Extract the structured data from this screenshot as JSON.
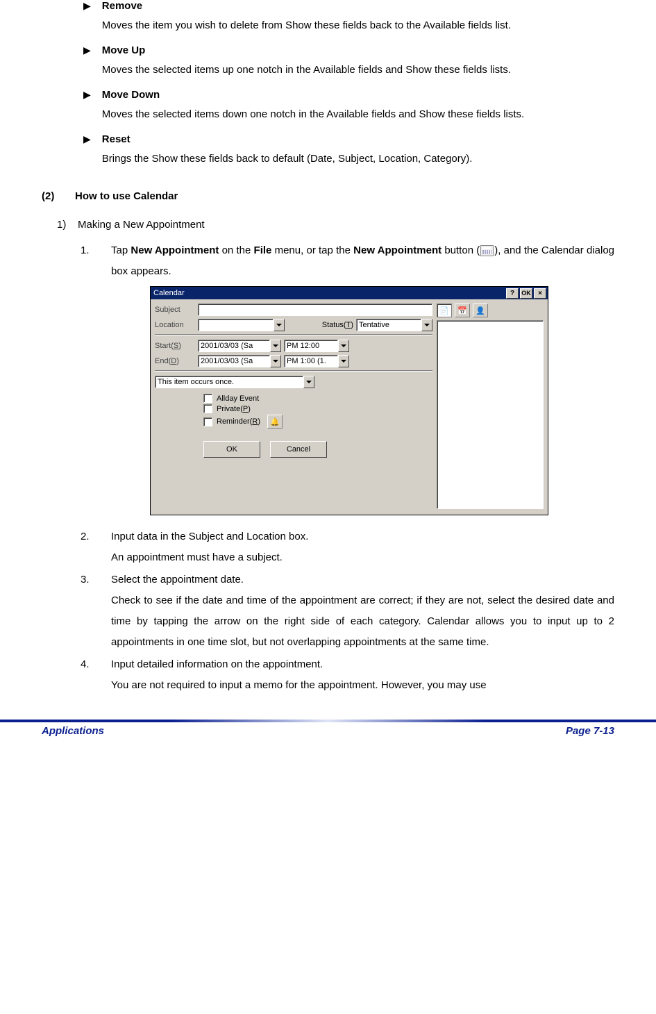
{
  "bullets": [
    {
      "title": "Remove",
      "desc": "Moves the item you wish to delete from Show these fields back to the Available fields list."
    },
    {
      "title": "Move Up",
      "desc": "Moves the selected items up one notch in the Available fields and Show these fields lists."
    },
    {
      "title": "Move Down",
      "desc": "Moves the selected items down one notch in the Available fields and Show these fields lists."
    },
    {
      "title": "Reset",
      "desc": "Brings the Show these fields back to default (Date, Subject, Location, Category)."
    }
  ],
  "section": {
    "num": "(2)",
    "title": "How to use Calendar"
  },
  "sub": {
    "num": "1)",
    "title": "Making a New Appointment"
  },
  "steps": {
    "s1": {
      "num": "1.",
      "lead_a": "Tap ",
      "b1": "New Appointment",
      "mid1": " on the ",
      "b2": "File",
      "mid2": " menu, or tap the ",
      "b3": "New Appointment",
      "tail": " button (",
      "tail2": "), and the Calendar dialog box appears."
    },
    "s2": {
      "num": "2.",
      "text": "Input data in the Subject and Location box.",
      "sub": "An appointment must have a subject."
    },
    "s3": {
      "num": "3.",
      "text": "Select the appointment date.",
      "sub": "Check to see if the date and time of the appointment are correct; if they are not, select the desired date and time by tapping the arrow on the right side of each category. Calendar allows you to input up to 2 appointments in one time slot, but not overlapping appointments at the same time."
    },
    "s4": {
      "num": "4.",
      "text": "Input detailed information on the appointment.",
      "sub": "You are not required to input a memo for the appointment. However, you may use"
    }
  },
  "dialog": {
    "title": "Calendar",
    "help": "?",
    "ok_cap": "OK",
    "close": "×",
    "subject_lbl": "Subject",
    "location_lbl": "Location",
    "status_lbl": "Status(",
    "status_key": "T",
    "status_lbl2": ")",
    "status_val": "Tentative",
    "start_lbl": "Start(",
    "start_key": "S",
    "start_lbl2": ")",
    "end_lbl": "End(",
    "end_key": "D",
    "end_lbl2": ")",
    "start_date": "2001/03/03 (Sa",
    "end_date": "2001/03/03 (Sa",
    "start_time": "PM 12:00",
    "end_time": "PM 1:00 (1.",
    "recur": "This item occurs once.",
    "allday": "Allday Event",
    "private_a": "Private(",
    "private_key": "P",
    "private_b": ")",
    "reminder_a": "Reminder(",
    "reminder_key": "R",
    "reminder_b": ")",
    "ok": "OK",
    "cancel": "Cancel"
  },
  "footer": {
    "left": "Applications",
    "right": "Page 7-13"
  }
}
